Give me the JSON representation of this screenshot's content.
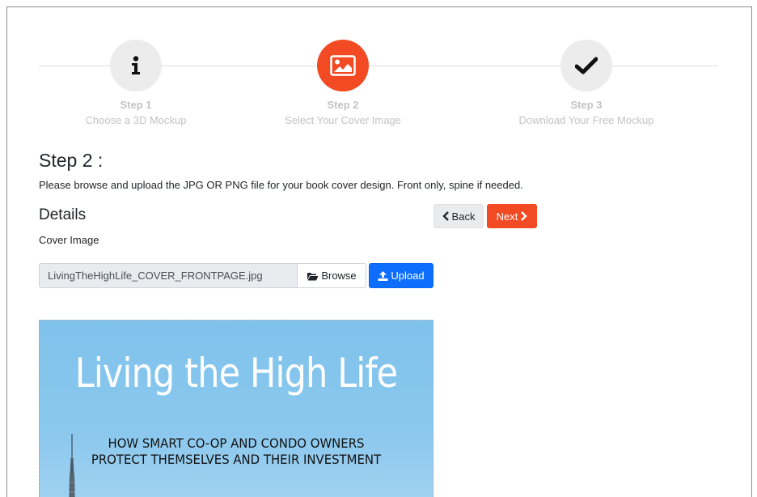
{
  "stepper": {
    "steps": [
      {
        "number": "Step 1",
        "label": "Choose a 3D Mockup",
        "icon": "info-icon"
      },
      {
        "number": "Step 2",
        "label": "Select Your Cover Image",
        "icon": "image-icon"
      },
      {
        "number": "Step 3",
        "label": "Download Your Free Mockup",
        "icon": "checkmark-icon"
      }
    ],
    "active_step": 2
  },
  "main": {
    "heading": "Step 2 :",
    "instructions": "Please browse and upload the JPG OR PNG file for your book cover design. Front only, spine if needed.",
    "details_heading": "Details",
    "cover_image_label": "Cover Image"
  },
  "nav": {
    "back_label": "Back",
    "next_label": "Next"
  },
  "file": {
    "filename": "LivingTheHighLife_COVER_FRONTPAGE.jpg",
    "browse_label": "Browse",
    "upload_label": "Upload"
  },
  "cover": {
    "title": "Living the High Life",
    "subtitle_line1": "HOW SMART CO-OP AND CONDO OWNERS",
    "subtitle_line2": "PROTECT THEMSELVES AND THEIR INVESTMENT"
  },
  "colors": {
    "accent": "#f24a23",
    "primary": "#0d6efd",
    "muted_text": "#c3c3c3",
    "cover_sky": "#85c5ed"
  }
}
